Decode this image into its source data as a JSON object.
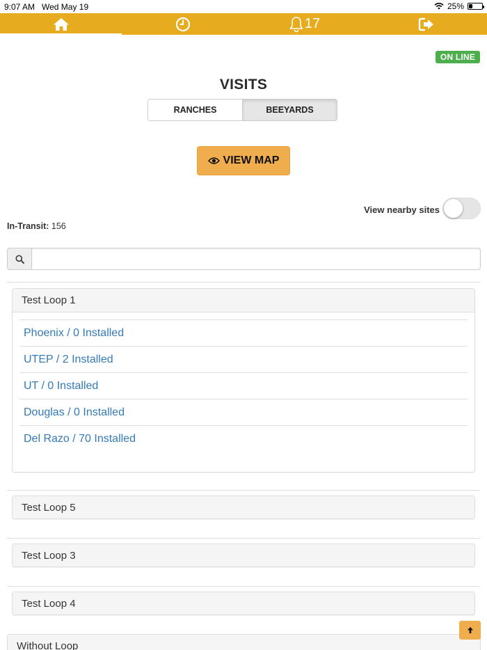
{
  "status_bar": {
    "time": "9:07 AM",
    "date": "Wed May 19",
    "battery": "25%",
    "battery_level": 0.25
  },
  "nav": {
    "items": [
      {
        "icon": "home-icon",
        "active": true
      },
      {
        "icon": "clock-icon"
      },
      {
        "icon": "bell-icon",
        "count": "17"
      },
      {
        "icon": "sign-out-icon"
      }
    ]
  },
  "badge": {
    "label": "ON LINE",
    "color": "#4cae4c"
  },
  "page": {
    "title": "VISITS"
  },
  "tabs": [
    {
      "label": "RANCHES",
      "selected": false
    },
    {
      "label": "BEEYARDS",
      "selected": true
    }
  ],
  "view_map": {
    "label": "VIEW MAP",
    "icon": "eye-icon"
  },
  "nearby": {
    "label": "View nearby sites",
    "enabled": false
  },
  "in_transit": {
    "label": "In-Transit:",
    "value": "156"
  },
  "search": {
    "value": "",
    "placeholder": ""
  },
  "groups": [
    {
      "title": "Test Loop 1",
      "expanded": true,
      "items": [
        "Phoenix / 0 Installed",
        "UTEP / 2 Installed",
        "UT / 0 Installed",
        "Douglas / 0 Installed",
        "Del Razo / 70 Installed"
      ]
    },
    {
      "title": "Test Loop 5",
      "expanded": false
    },
    {
      "title": "Test Loop 3",
      "expanded": false
    },
    {
      "title": "Test Loop 4",
      "expanded": false
    },
    {
      "title": "Without Loop",
      "expanded": false
    }
  ],
  "colors": {
    "accent": "#e6ab1e",
    "button": "#f0ad4e",
    "link": "#337ab7"
  }
}
